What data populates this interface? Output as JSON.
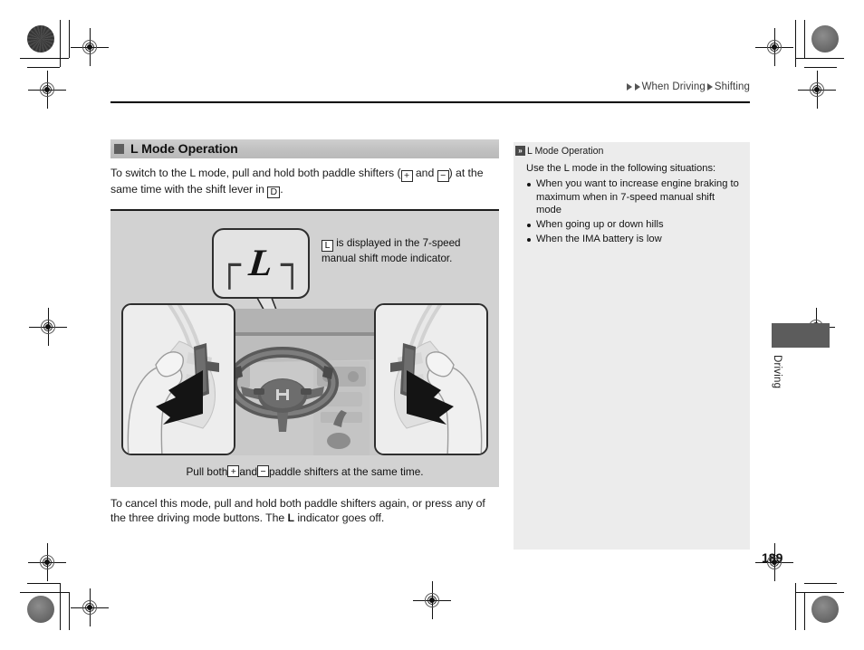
{
  "page": {
    "number": "189",
    "side_tab_label": "Driving",
    "breadcrumb": [
      "When Driving",
      "Shifting"
    ]
  },
  "section": {
    "heading": "L Mode Operation",
    "intro_parts": {
      "a": "To switch to the L mode, pull and hold both paddle shifters (",
      "plus": "+",
      "b": " and ",
      "minus": "−",
      "c": ") at the same time with the shift lever in ",
      "gear": "D",
      "d": "."
    },
    "tail_parts": {
      "a": "To cancel this mode, pull and hold both paddle shifters again, or press any of the three driving mode buttons. The ",
      "bold": "L",
      "b": " indicator goes off."
    }
  },
  "illustration": {
    "indicator_glyph": "L",
    "bracket_left": "┌",
    "bracket_right": "┐",
    "callout_parts": {
      "key": "L",
      "text": " is displayed in the 7-speed manual shift mode indicator."
    },
    "caption_parts": {
      "a": "Pull both ",
      "plus": "+",
      "b": " and ",
      "minus": "−",
      "c": " paddle shifters at the same time."
    }
  },
  "note": {
    "chevron": "»",
    "title": "L Mode Operation",
    "lead": "Use the L mode in the following situations:",
    "items": [
      "When you want to increase engine braking to maximum when in 7-speed manual shift mode",
      "When going up or down hills",
      "When the IMA battery is low"
    ]
  },
  "colors": {
    "heading_bar": "#c4c4c4",
    "illustration_bg": "#d2d2d2",
    "note_bg": "#ececec",
    "tab_block": "#5c5c5c"
  }
}
